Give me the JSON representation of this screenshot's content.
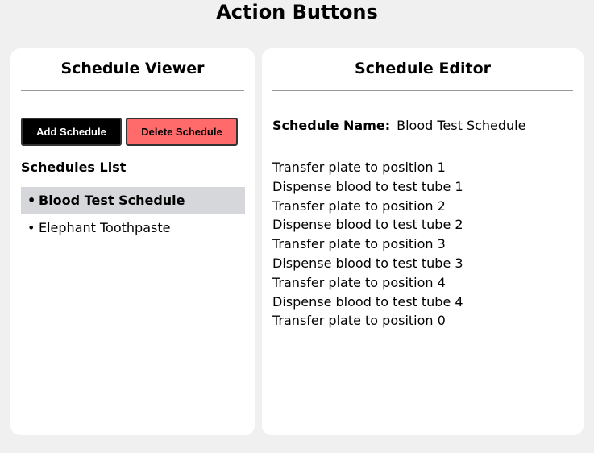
{
  "page": {
    "title": "Action Buttons"
  },
  "viewer": {
    "title": "Schedule Viewer",
    "add_button": "Add Schedule",
    "delete_button": "Delete Schedule",
    "list_title": "Schedules List",
    "bullet": "•",
    "items": [
      {
        "label": "Blood Test Schedule",
        "selected": true
      },
      {
        "label": "Elephant Toothpaste",
        "selected": false
      }
    ]
  },
  "editor": {
    "title": "Schedule Editor",
    "name_label": "Schedule Name:",
    "name_value": "Blood Test Schedule",
    "steps": [
      "Transfer plate to position 1",
      "Dispense blood to test tube 1",
      "Transfer plate to position 2",
      "Dispense blood to test tube 2",
      "Transfer plate to position 3",
      "Dispense blood to test tube 3",
      "Transfer plate to position 4",
      "Dispense blood to test tube 4",
      "Transfer plate to position 0"
    ]
  },
  "colors": {
    "background": "#f0f0f0",
    "panel": "#ffffff",
    "add_button_bg": "#000000",
    "delete_button_bg": "#ff6b6b",
    "selected_item_bg": "#d5d7db"
  }
}
